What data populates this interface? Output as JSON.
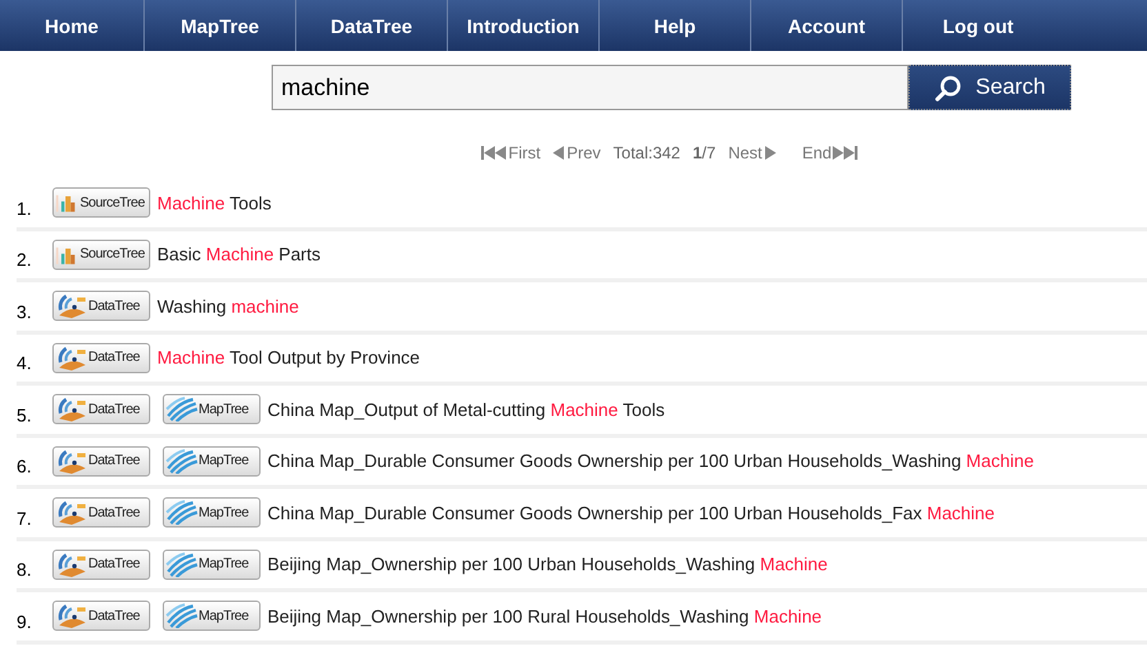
{
  "nav": [
    {
      "label": "Home"
    },
    {
      "label": "MapTree"
    },
    {
      "label": "DataTree"
    },
    {
      "label": "Introduction"
    },
    {
      "label": "Help"
    },
    {
      "label": "Account"
    },
    {
      "label": "Log out"
    }
  ],
  "search": {
    "value": "machine",
    "button": "Search"
  },
  "pager": {
    "first": "First",
    "prev": "Prev",
    "total": "Total:342",
    "page": "**1**/7",
    "next": "Nest",
    "end": "End"
  },
  "results": [
    {
      "number": "1.",
      "badges": [
        {
          "kind": "source",
          "label": "SourceTree"
        }
      ],
      "title": [
        {
          "text": "Machine",
          "highlight": true
        },
        {
          "text": " Tools",
          "highlight": false
        }
      ]
    },
    {
      "number": "2.",
      "badges": [
        {
          "kind": "source",
          "label": "SourceTree"
        }
      ],
      "title": [
        {
          "text": "Basic ",
          "highlight": false
        },
        {
          "text": "Machine",
          "highlight": true
        },
        {
          "text": " Parts",
          "highlight": false
        }
      ]
    },
    {
      "number": "3.",
      "badges": [
        {
          "kind": "data",
          "label": "DataTree"
        }
      ],
      "title": [
        {
          "text": "Washing ",
          "highlight": false
        },
        {
          "text": "machine",
          "highlight": true
        }
      ]
    },
    {
      "number": "4.",
      "badges": [
        {
          "kind": "data",
          "label": "DataTree"
        }
      ],
      "title": [
        {
          "text": "Machine",
          "highlight": true
        },
        {
          "text": " Tool Output by Province",
          "highlight": false
        }
      ]
    },
    {
      "number": "5.",
      "badges": [
        {
          "kind": "data",
          "label": "DataTree"
        },
        {
          "kind": "map",
          "label": "MapTree"
        }
      ],
      "title": [
        {
          "text": "China Map_Output of Metal-cutting ",
          "highlight": false
        },
        {
          "text": "Machine",
          "highlight": true
        },
        {
          "text": " Tools",
          "highlight": false
        }
      ]
    },
    {
      "number": "6.",
      "badges": [
        {
          "kind": "data",
          "label": "DataTree"
        },
        {
          "kind": "map",
          "label": "MapTree"
        }
      ],
      "title": [
        {
          "text": "China Map_Durable Consumer Goods Ownership per 100 Urban Households_Washing ",
          "highlight": false
        },
        {
          "text": "Machine",
          "highlight": true
        }
      ]
    },
    {
      "number": "7.",
      "badges": [
        {
          "kind": "data",
          "label": "DataTree"
        },
        {
          "kind": "map",
          "label": "MapTree"
        }
      ],
      "title": [
        {
          "text": "China Map_Durable Consumer Goods Ownership per 100 Urban Households_Fax ",
          "highlight": false
        },
        {
          "text": "Machine",
          "highlight": true
        }
      ]
    },
    {
      "number": "8.",
      "badges": [
        {
          "kind": "data",
          "label": "DataTree"
        },
        {
          "kind": "map",
          "label": "MapTree"
        }
      ],
      "title": [
        {
          "text": "Beijing Map_Ownership per 100 Urban Households_Washing ",
          "highlight": false
        },
        {
          "text": "Machine",
          "highlight": true
        }
      ]
    },
    {
      "number": "9.",
      "badges": [
        {
          "kind": "data",
          "label": "DataTree"
        },
        {
          "kind": "map",
          "label": "MapTree"
        }
      ],
      "title": [
        {
          "text": "Beijing Map_Ownership per 100 Rural Households_Washing ",
          "highlight": false
        },
        {
          "text": "Machine",
          "highlight": true
        }
      ]
    }
  ]
}
